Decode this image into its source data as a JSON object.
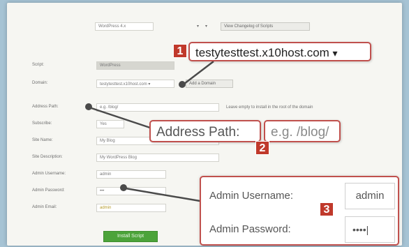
{
  "top_controls": {
    "version_select": "WordPress 4.x",
    "version_arrow": "▾",
    "view_changelog": "View Changelog of Scripts"
  },
  "form": {
    "labels": {
      "script": "Script:",
      "domain": "Domain:",
      "address_path": "Address Path:",
      "subscribe": "Subscribe:",
      "site_name": "Site Name:",
      "site_description": "Site Description:",
      "admin_username": "Admin Username:",
      "admin_password": "Admin Password:",
      "admin_email": "Admin Email:"
    },
    "values": {
      "script": "WordPress",
      "domain": "testytesttest.x10host.com ▾",
      "address_path": "e.g. /blog/",
      "subscribe": "Yes",
      "site_name": "My Blog",
      "site_description": "My WordPress Blog",
      "admin_username": "admin",
      "admin_password": "•••",
      "admin_email": "admin"
    },
    "add_domain": "Add a Domain",
    "address_hint": "Leave empty to install in the root of the domain",
    "install_button": "Install Script"
  },
  "callouts": {
    "one": {
      "number": "1",
      "text": "testytesttest.x10host.com",
      "arrow": "▾"
    },
    "two": {
      "number": "2",
      "label": "Address Path:",
      "value": "e.g. /blog/"
    },
    "three": {
      "number": "3",
      "username_label": "Admin Username:",
      "username_value": "admin",
      "password_label": "Admin Password:",
      "password_value": "••••|"
    }
  },
  "colors": {
    "accent_red": "#c0392b",
    "callout_border": "#c0504d",
    "install_green": "#4ca33a",
    "background_blue": "#a6c3d4"
  }
}
